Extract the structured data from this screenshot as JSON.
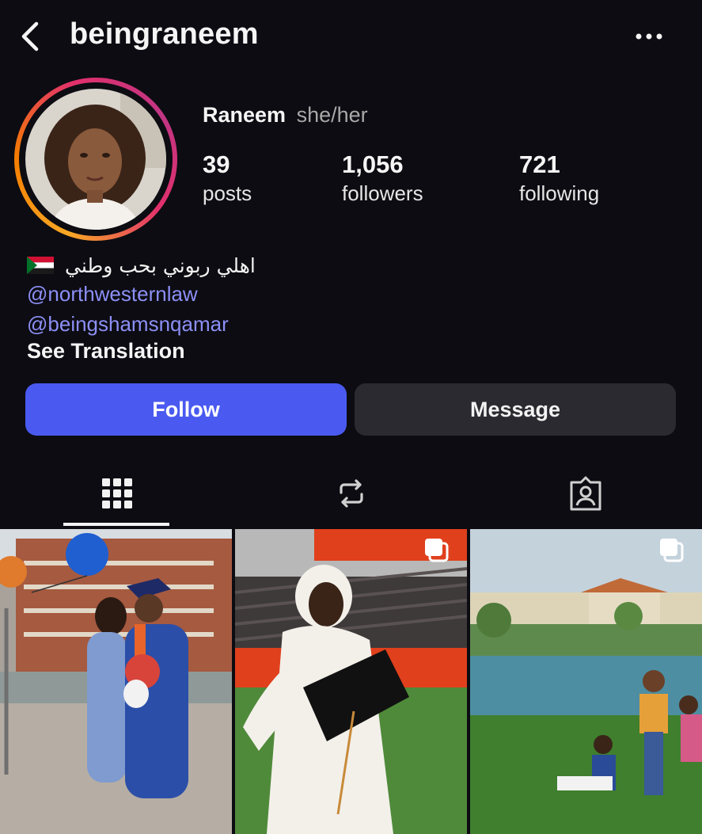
{
  "header": {
    "username": "beingraneem",
    "back_icon": "chevron-left-icon",
    "more_icon": "more-horizontal-icon"
  },
  "profile": {
    "name": "Raneem",
    "pronouns": "she/her",
    "stats": [
      {
        "value": "39",
        "label": "posts"
      },
      {
        "value": "1,056",
        "label": "followers"
      },
      {
        "value": "721",
        "label": "following"
      }
    ]
  },
  "bio": {
    "flag_icon": "sudan-flag-icon",
    "text": "اهلي ربوني بحب وطني",
    "links": [
      "@northwesternlaw",
      "@beingshamsnqamar"
    ],
    "see_translation": "See Translation"
  },
  "actions": {
    "follow_label": "Follow",
    "message_label": "Message"
  },
  "tabs": [
    {
      "icon": "grid-icon",
      "active": true
    },
    {
      "icon": "reels-repost-icon",
      "active": false
    },
    {
      "icon": "tagged-person-icon",
      "active": false
    }
  ],
  "posts": [
    {
      "scene": "graduation-couple-balloons",
      "multi": false
    },
    {
      "scene": "graduate-white-hijab-stadium",
      "multi": true
    },
    {
      "scene": "children-park-lake",
      "multi": true
    }
  ],
  "colors": {
    "background": "#0c0c12",
    "follow_button": "#4a5af0",
    "message_button": "#2a2a30",
    "link": "#8c8ff5",
    "secondary_text": "#a8a8a8"
  }
}
